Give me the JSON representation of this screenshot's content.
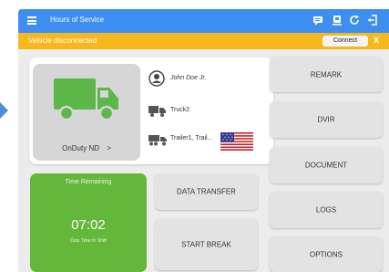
{
  "app": {
    "title": "Hours of Service"
  },
  "banner": {
    "message": "Vehicle disconnected",
    "connect_label": "Connect",
    "close_label": "X"
  },
  "status": {
    "duty_label": "OnDuty ND",
    "duty_chevron": ">"
  },
  "driver": {
    "name": "John Doe Jr.",
    "truck": "Truck2",
    "trailers": "Trailer1, Trail..."
  },
  "timer": {
    "title": "Time Remaining",
    "value": "07:02",
    "subtitle": "Duty Time In Shift"
  },
  "actions": {
    "remark": "REMARK",
    "dvir": "DVIR",
    "document": "DOCUMENT",
    "logs": "LOGS",
    "options": "OPTIONS",
    "data_transfer": "DATA TRANSFER",
    "start_break": "START BREAK"
  },
  "icons": [
    "menu-icon",
    "message-icon",
    "device-icon",
    "refresh-icon",
    "logout-icon",
    "person-icon",
    "truck-icon",
    "trailer-icon",
    "us-flag-icon"
  ],
  "colors": {
    "appbar": "#3d8ef0",
    "banner": "#f6b81c",
    "truck": "#5cb648",
    "timer": "#63b83c"
  }
}
